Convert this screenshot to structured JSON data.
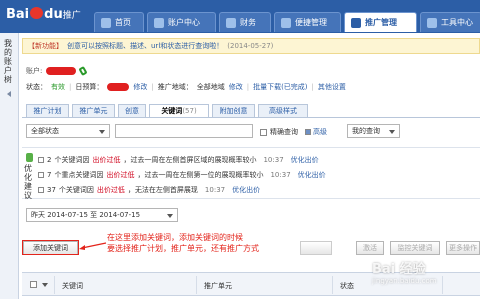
{
  "header": {
    "logo_text": "Bai",
    "logo_text2": "du",
    "logo_sub": "推广",
    "nav": [
      {
        "label": "首页"
      },
      {
        "label": "账户中心"
      },
      {
        "label": "财务"
      },
      {
        "label": "便捷管理"
      },
      {
        "label": "推广管理"
      },
      {
        "label": "工具中心"
      }
    ]
  },
  "sidebar": {
    "label": "我的账户树"
  },
  "notice": {
    "tag": "【新功能】",
    "message": "创意可以按照标题、描述、url和状态进行查询啦！",
    "date": "(2014-05-27)"
  },
  "account": {
    "account_label": "账户:",
    "status_label": "状态：",
    "status_value": "有效",
    "budget_label": "日预算：",
    "budget_edit": "修改",
    "region_label": "推广地域：",
    "region_value": "全部地域",
    "region_edit": "修改",
    "ip_exclude": "批量下载(已完成)",
    "other_settings": "其他设置"
  },
  "subtabs": [
    {
      "label": "推广计划"
    },
    {
      "label": "推广单元"
    },
    {
      "label": "创意"
    },
    {
      "label": "关键词",
      "count": "(57)"
    },
    {
      "label": "附加创意"
    },
    {
      "label": "高级样式"
    }
  ],
  "filter": {
    "status_select": "全部状态",
    "exact_label": "精确查询",
    "advanced_label": "高级",
    "my_query": "我的查询"
  },
  "optimization": {
    "side_label": "优化建议",
    "rows": [
      {
        "count": "2",
        "text": "个关键词因",
        "flag": "出价过低",
        "rest": "，过去一周在左侧首屏区域的展现概率较小",
        "time": "10:37",
        "action": "优化出价"
      },
      {
        "count": "7",
        "text": "个重点关键词因",
        "flag": "出价过低",
        "rest": "，过去一周在左侧第一位的展现概率较小",
        "time": "10:37",
        "action": "优化出价"
      },
      {
        "count": "37",
        "text": "个关键词因",
        "flag": "出价过低",
        "rest": "，无法在左侧首屏展现",
        "time": "10:37",
        "action": "优化出价"
      }
    ]
  },
  "date_range": {
    "value": "昨天 2014-07-15 至 2014-07-15"
  },
  "toolbar": {
    "add_keyword": "添加关键词",
    "activate": "激活",
    "monitor": "监控关键词",
    "more": "更多操作"
  },
  "annotation": {
    "line1": "在这里添加关键词，添加关键词的时候",
    "line2": "要选择推广计划，推广单元，还有推广方式"
  },
  "table": {
    "headers": [
      "关键词",
      "推广单元",
      "状态"
    ]
  },
  "watermark": {
    "main": "Bai 经验",
    "sub": "jingyan.baidu.com"
  }
}
